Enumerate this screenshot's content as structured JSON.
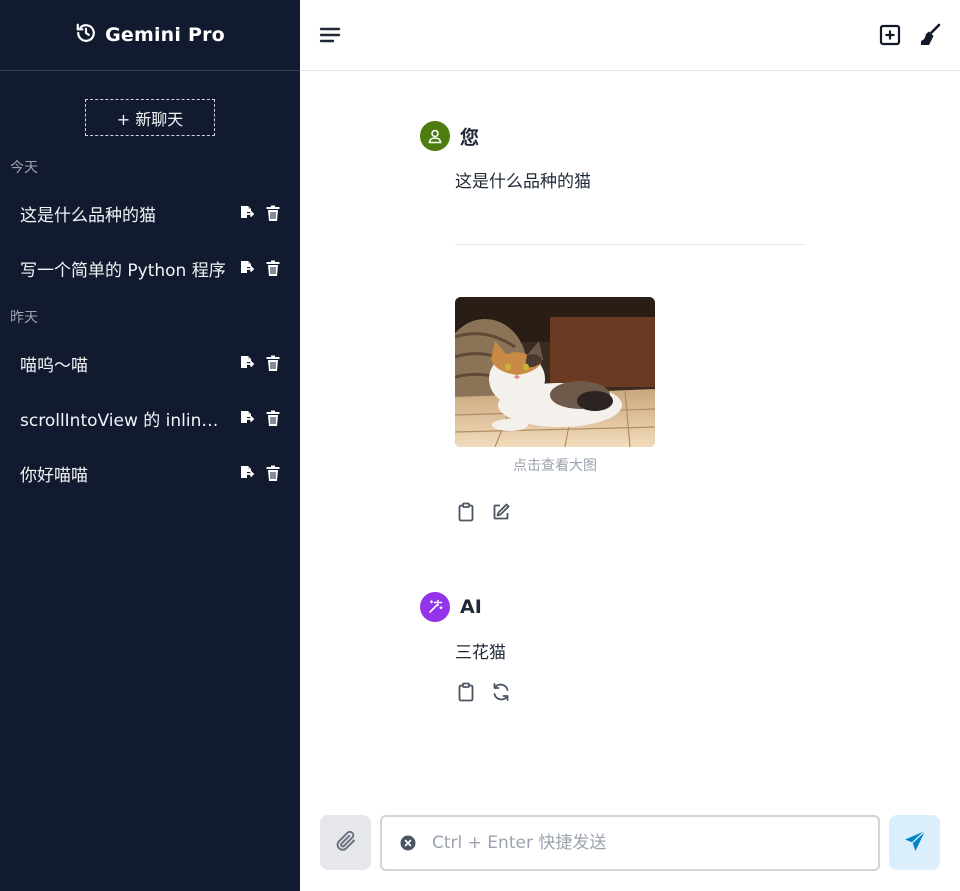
{
  "app": {
    "title": "Gemini Pro"
  },
  "sidebar": {
    "new_chat_label": "+ 新聊天",
    "groups": [
      {
        "label": "今天",
        "items": [
          {
            "label": "这是什么品种的猫"
          },
          {
            "label": "写一个简单的 Python 程序"
          }
        ]
      },
      {
        "label": "昨天",
        "items": [
          {
            "label": "喵呜〜喵"
          },
          {
            "label": "scrollIntoView 的 inline 参数"
          },
          {
            "label": "你好喵喵"
          }
        ]
      }
    ]
  },
  "conversation": {
    "user": {
      "name": "您",
      "text": "这是什么品种的猫",
      "image_caption": "点击查看大图",
      "avatar_color": "#4d7c0f"
    },
    "ai": {
      "name": "AI",
      "text": "三花猫",
      "avatar_color": "#9333ea"
    }
  },
  "composer": {
    "placeholder": "Ctrl + Enter 快捷发送",
    "send_color": "#0284c7"
  },
  "icons": {
    "history": "history-icon",
    "export": "export-file-icon",
    "delete": "trash-icon",
    "menu": "menu-icon",
    "new": "plus-square-icon",
    "clear": "broom-icon",
    "copy": "clipboard-icon",
    "edit": "edit-icon",
    "regenerate": "refresh-icon",
    "attach": "paperclip-icon",
    "clear_input": "x-circle-icon",
    "send": "send-icon"
  }
}
